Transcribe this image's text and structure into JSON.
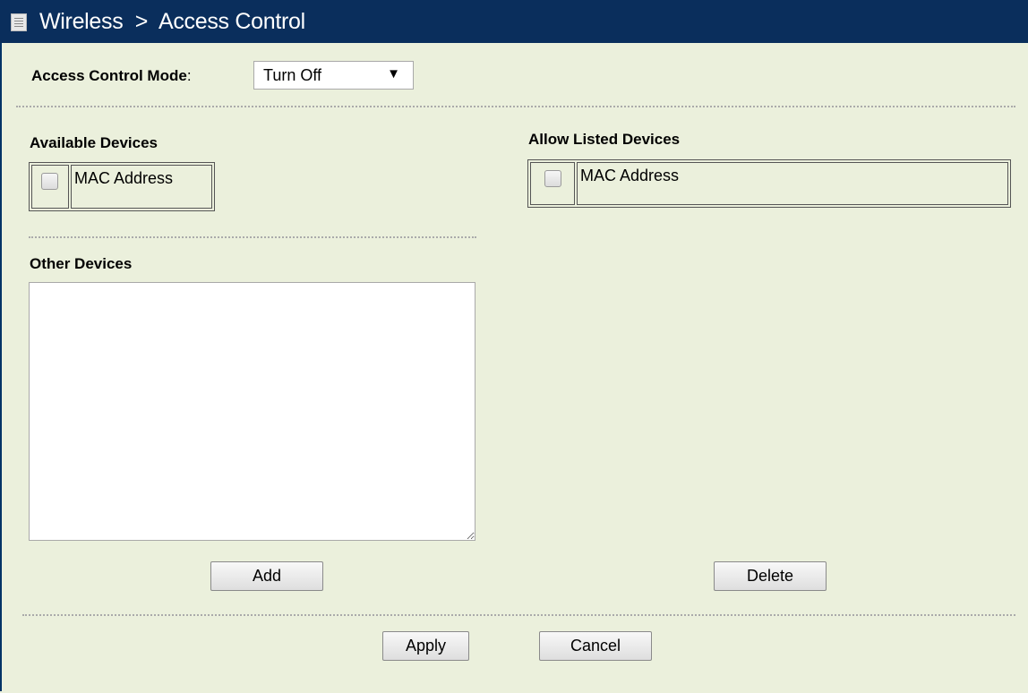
{
  "header": {
    "title": "Wireless  >  Access Control",
    "icon": "menu-page-icon"
  },
  "mode": {
    "label": "Access Control Mode",
    "colon": ":",
    "selected": "Turn Off",
    "arrow": "▼"
  },
  "available": {
    "title": "Available Devices",
    "column": "MAC Address"
  },
  "allowed": {
    "title": "Allow Listed Devices",
    "column": "MAC Address"
  },
  "other": {
    "title": "Other Devices",
    "value": ""
  },
  "buttons": {
    "add": "Add",
    "delete": "Delete",
    "apply": "Apply",
    "cancel": "Cancel"
  },
  "colors": {
    "header_bg": "#0a2e5c",
    "page_bg": "#ebf0dc"
  }
}
